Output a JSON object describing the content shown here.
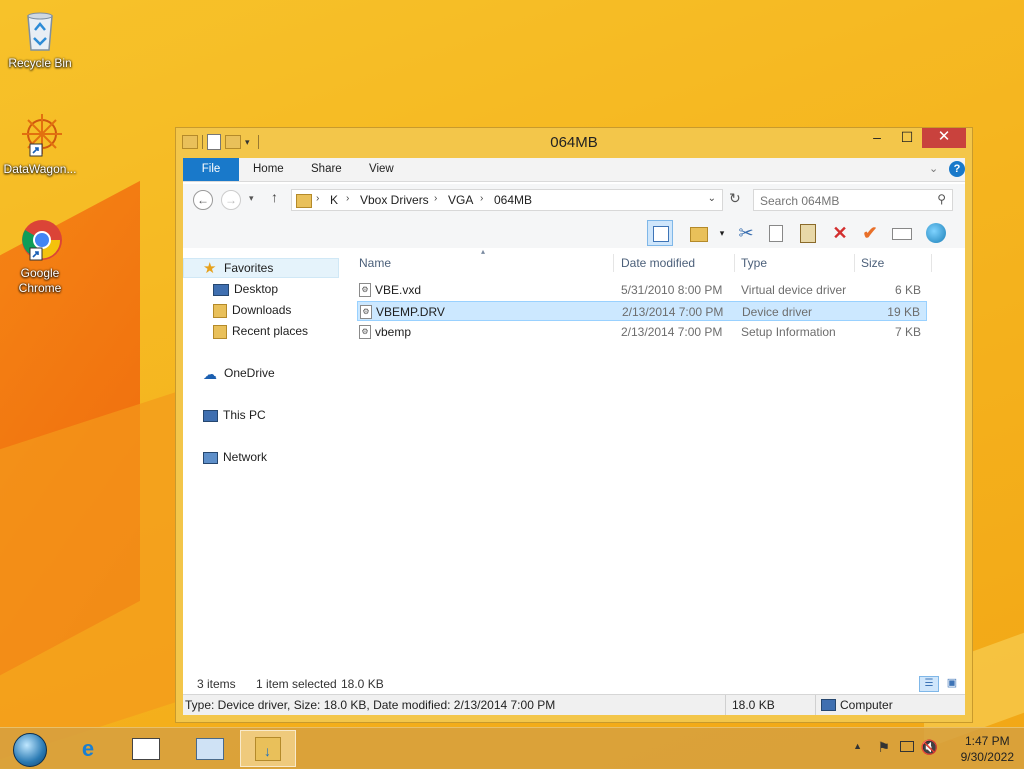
{
  "desktop": {
    "icons": [
      {
        "label": "Recycle Bin",
        "icon": "recycle-bin-icon"
      },
      {
        "label": "DataWagon...",
        "icon": "datawagon-icon"
      },
      {
        "label": "Google Chrome",
        "icon": "chrome-icon"
      }
    ]
  },
  "window": {
    "title": "064MB",
    "controls": {
      "minimize": "–",
      "maximize": "☐",
      "close": "✕"
    },
    "ribbon": {
      "file": "File",
      "home": "Home",
      "share": "Share",
      "view": "View"
    },
    "address": {
      "crumbs": [
        "K",
        "Vbox Drivers",
        "VGA",
        "064MB"
      ]
    },
    "search": {
      "placeholder": "Search 064MB"
    },
    "nav": {
      "favorites": "Favorites",
      "desktop": "Desktop",
      "downloads": "Downloads",
      "recent": "Recent places",
      "onedrive": "OneDrive",
      "thispc": "This PC",
      "network": "Network"
    },
    "columns": {
      "name": "Name",
      "date": "Date modified",
      "type": "Type",
      "size": "Size"
    },
    "files": [
      {
        "name": "VBE.vxd",
        "date": "5/31/2010 8:00 PM",
        "type": "Virtual device driver",
        "size": "6 KB",
        "selected": false
      },
      {
        "name": "VBEMP.DRV",
        "date": "2/13/2014 7:00 PM",
        "type": "Device driver",
        "size": "19 KB",
        "selected": true
      },
      {
        "name": "vbemp",
        "date": "2/13/2014 7:00 PM",
        "type": "Setup Information",
        "size": "7 KB",
        "selected": false
      }
    ],
    "status": {
      "items": "3 items",
      "selected": "1 item selected",
      "selected_size": "18.0 KB",
      "details": "Type: Device driver, Size: 18.0 KB, Date modified: 2/13/2014 7:00 PM",
      "size": "18.0 KB",
      "location": "Computer"
    }
  },
  "taskbar": {
    "time": "1:47 PM",
    "date": "9/30/2022"
  },
  "colors": {
    "accent": "#1979ca",
    "selection": "#cce8ff",
    "close": "#c9423d",
    "desktop": "#f5b51f"
  }
}
